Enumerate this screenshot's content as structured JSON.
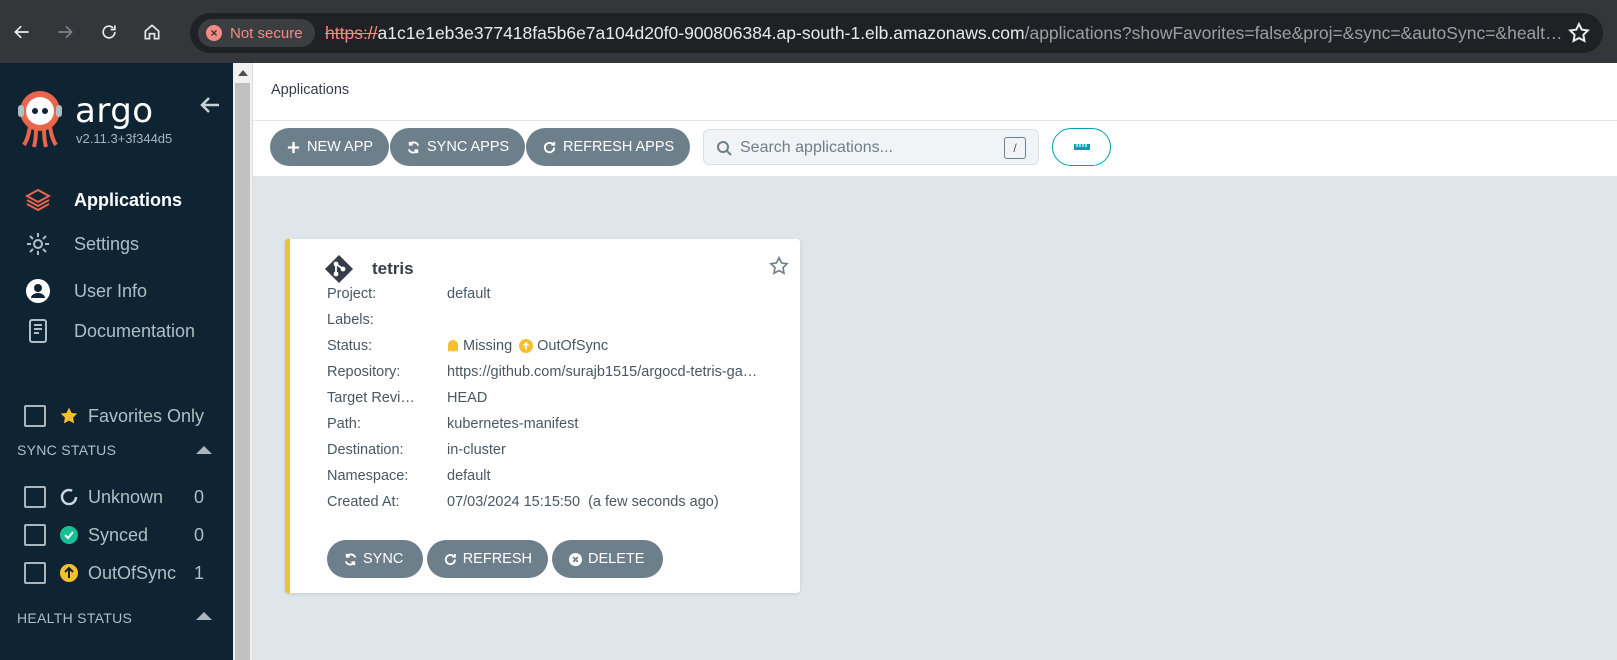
{
  "browser": {
    "security_label": "Not secure",
    "url_scheme": "https://",
    "url_host": "a1c1e1eb3e377418fa5b6e7a104d20f0-900806384.ap-south-1.elb.amazonaws.com",
    "url_path": "/applications?showFavorites=false&proj=&sync=&autoSync=&healt…"
  },
  "sidebar": {
    "logo_text": "argo",
    "version": "v2.11.3+3f344d5",
    "menu": [
      {
        "label": "Applications",
        "icon": "applications-icon",
        "active": true
      },
      {
        "label": "Settings",
        "icon": "settings-icon",
        "active": false
      },
      {
        "label": "User Info",
        "icon": "user-icon",
        "active": false
      },
      {
        "label": "Documentation",
        "icon": "documentation-icon",
        "active": false
      }
    ],
    "favorites_label": "Favorites Only",
    "sync_status": {
      "title": "SYNC STATUS",
      "items": [
        {
          "label": "Unknown",
          "count": "0",
          "color": "#ccd6dd"
        },
        {
          "label": "Synced",
          "count": "0",
          "color": "#18be94"
        },
        {
          "label": "OutOfSync",
          "count": "1",
          "color": "#f4c030"
        }
      ]
    },
    "health_status": {
      "title": "HEALTH STATUS"
    }
  },
  "header": {
    "title": "Applications"
  },
  "toolbar": {
    "new_app": "NEW APP",
    "sync_apps": "SYNC APPS",
    "refresh_apps": "REFRESH APPS",
    "search_placeholder": "Search applications...",
    "search_shortcut": "/"
  },
  "app_card": {
    "name": "tetris",
    "fields": [
      {
        "key": "Project:",
        "value": "default"
      },
      {
        "key": "Labels:",
        "value": ""
      },
      {
        "key": "Status:",
        "value": ""
      },
      {
        "key": "Repository:",
        "value": "https://github.com/surajb1515/argocd-tetris-ga…"
      },
      {
        "key": "Target Revi…",
        "value": "HEAD"
      },
      {
        "key": "Path:",
        "value": "kubernetes-manifest"
      },
      {
        "key": "Destination:",
        "value": "in-cluster"
      },
      {
        "key": "Namespace:",
        "value": "default"
      },
      {
        "key": "Created At:",
        "value": "07/03/2024 15:15:50  (a few seconds ago)"
      }
    ],
    "health": "Missing",
    "sync": "OutOfSync",
    "actions": {
      "sync": "SYNC",
      "refresh": "REFRESH",
      "delete": "DELETE"
    },
    "accent_color": "#f4c030"
  }
}
